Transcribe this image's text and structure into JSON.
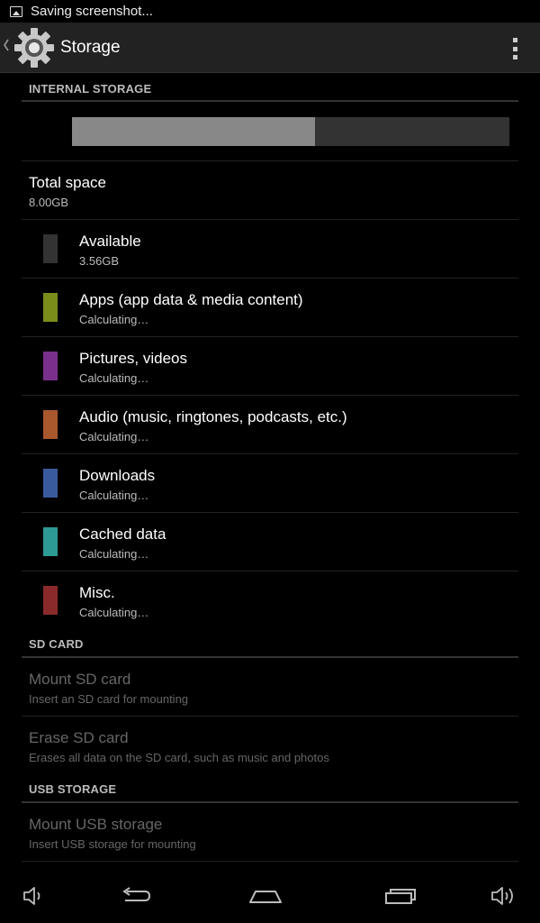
{
  "status_bar": {
    "notification_text": "Saving screenshot..."
  },
  "action_bar": {
    "title": "Storage",
    "icon": "settings-gear-icon"
  },
  "internal_storage": {
    "header": "INTERNAL STORAGE",
    "used_fraction": 0.555,
    "total_space": {
      "title": "Total space",
      "summary": "8.00GB"
    },
    "items": [
      {
        "title": "Available",
        "summary": "3.56GB",
        "color": "#333333"
      },
      {
        "title": "Apps (app data & media content)",
        "summary": "Calculating…",
        "color": "#7a8c1a"
      },
      {
        "title": "Pictures, videos",
        "summary": "Calculating…",
        "color": "#7b2f8c"
      },
      {
        "title": "Audio (music, ringtones, podcasts, etc.)",
        "summary": "Calculating…",
        "color": "#a8582c"
      },
      {
        "title": "Downloads",
        "summary": "Calculating…",
        "color": "#3a5a9e"
      },
      {
        "title": "Cached data",
        "summary": "Calculating…",
        "color": "#2e9a96"
      },
      {
        "title": "Misc.",
        "summary": "Calculating…",
        "color": "#8a2a2a"
      }
    ]
  },
  "sd_card": {
    "header": "SD CARD",
    "mount": {
      "title": "Mount SD card",
      "summary": "Insert an SD card for mounting"
    },
    "erase": {
      "title": "Erase SD card",
      "summary": "Erases all data on the SD card, such as music and photos"
    }
  },
  "usb_storage": {
    "header": "USB STORAGE",
    "mount": {
      "title": "Mount USB storage",
      "summary": "Insert USB storage for mounting"
    }
  },
  "colors": {
    "used_bar": "#888888",
    "free_bar": "#333333",
    "action_bar_bg": "#222222"
  }
}
